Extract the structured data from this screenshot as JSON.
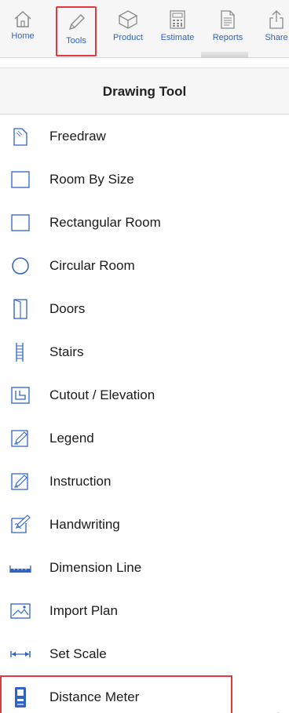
{
  "toolbar": {
    "items": [
      {
        "label": "Home",
        "icon": "home-icon"
      },
      {
        "label": "Tools",
        "icon": "pencil-icon",
        "selected": true
      },
      {
        "label": "Product",
        "icon": "box-icon"
      },
      {
        "label": "Estimate",
        "icon": "calculator-icon"
      },
      {
        "label": "Reports",
        "icon": "document-icon"
      },
      {
        "label": "Share",
        "icon": "share-icon"
      }
    ]
  },
  "header": {
    "title": "Drawing Tool"
  },
  "tools": [
    {
      "label": "Freedraw",
      "icon": "freedraw-icon"
    },
    {
      "label": "Room By Size",
      "icon": "square-icon"
    },
    {
      "label": "Rectangular Room",
      "icon": "square-icon"
    },
    {
      "label": "Circular Room",
      "icon": "circle-icon"
    },
    {
      "label": "Doors",
      "icon": "door-icon"
    },
    {
      "label": "Stairs",
      "icon": "stairs-icon"
    },
    {
      "label": "Cutout / Elevation",
      "icon": "cutout-icon"
    },
    {
      "label": "Legend",
      "icon": "legend-icon"
    },
    {
      "label": "Instruction",
      "icon": "instruction-icon"
    },
    {
      "label": "Handwriting",
      "icon": "handwriting-icon"
    },
    {
      "label": "Dimension Line",
      "icon": "dimension-line-icon"
    },
    {
      "label": "Import Plan",
      "icon": "image-icon"
    },
    {
      "label": "Set Scale",
      "icon": "scale-icon"
    },
    {
      "label": "Distance Meter",
      "icon": "distance-meter-icon",
      "highlighted": true
    }
  ],
  "colors": {
    "accent": "#2f63c9",
    "highlight": "#e0383e",
    "chevron": "#c5c5c5"
  },
  "chevron_glyph": ">"
}
